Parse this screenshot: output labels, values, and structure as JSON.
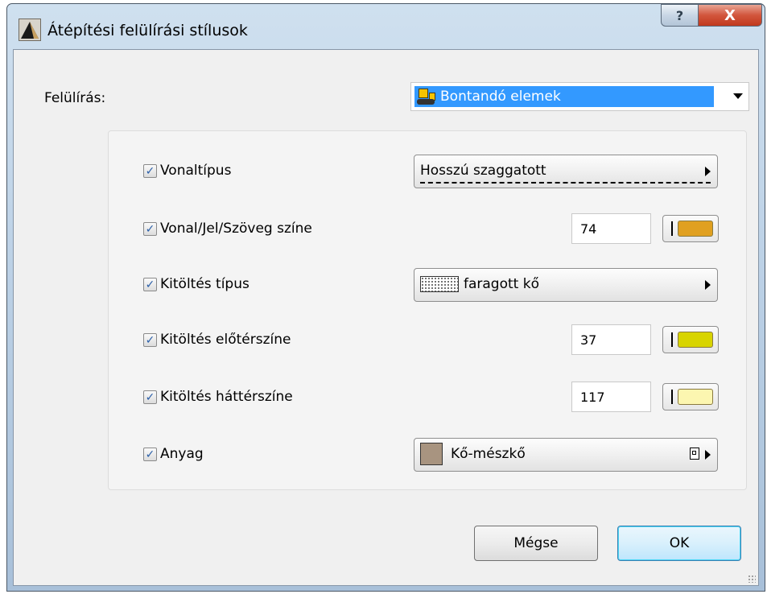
{
  "window": {
    "title": "Átépítési felülírási stílusok",
    "help_glyph": "?",
    "close_glyph": "X"
  },
  "override": {
    "label": "Felülírás:",
    "selected": "Bontandó elemek",
    "icon": "bulldozer-icon"
  },
  "rows": [
    {
      "label": "Vonaltípus",
      "checked": true,
      "control": "popup",
      "value": "Hosszú szaggatott"
    },
    {
      "label": "Vonal/Jel/Szöveg színe",
      "checked": true,
      "control": "pen",
      "value": "74",
      "color": "#e0a020"
    },
    {
      "label": "Kitöltés típus",
      "checked": true,
      "control": "popup",
      "value": "faragott kő"
    },
    {
      "label": "Kitöltés előtérszíne",
      "checked": true,
      "control": "pen",
      "value": "37",
      "color": "#d8d400"
    },
    {
      "label": "Kitöltés háttérszíne",
      "checked": true,
      "control": "pen",
      "value": "117",
      "color": "#fcf6b0"
    },
    {
      "label": "Anyag",
      "checked": true,
      "control": "popup",
      "value": "Kő-mészkő",
      "color": "#a89480"
    }
  ],
  "buttons": {
    "cancel": "Mégse",
    "ok": "OK"
  },
  "check_glyph": "✓"
}
